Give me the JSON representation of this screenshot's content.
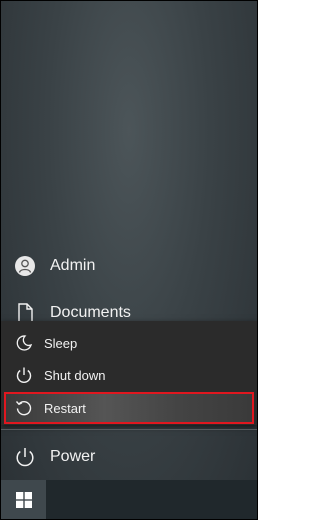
{
  "user": {
    "label": "Admin",
    "icon": "person-icon"
  },
  "documents": {
    "label": "Documents",
    "icon": "document-icon"
  },
  "power_menu": {
    "items": [
      {
        "label": "Sleep",
        "icon": "moon-icon"
      },
      {
        "label": "Shut down",
        "icon": "power-icon"
      },
      {
        "label": "Restart",
        "icon": "restart-icon",
        "highlighted": true
      }
    ]
  },
  "power": {
    "label": "Power",
    "icon": "power-icon"
  },
  "taskbar": {
    "start_icon": "windows-logo-icon"
  },
  "colors": {
    "highlight_border": "#e0171f",
    "taskbar": "#20282c",
    "start_button": "#3f484d"
  }
}
